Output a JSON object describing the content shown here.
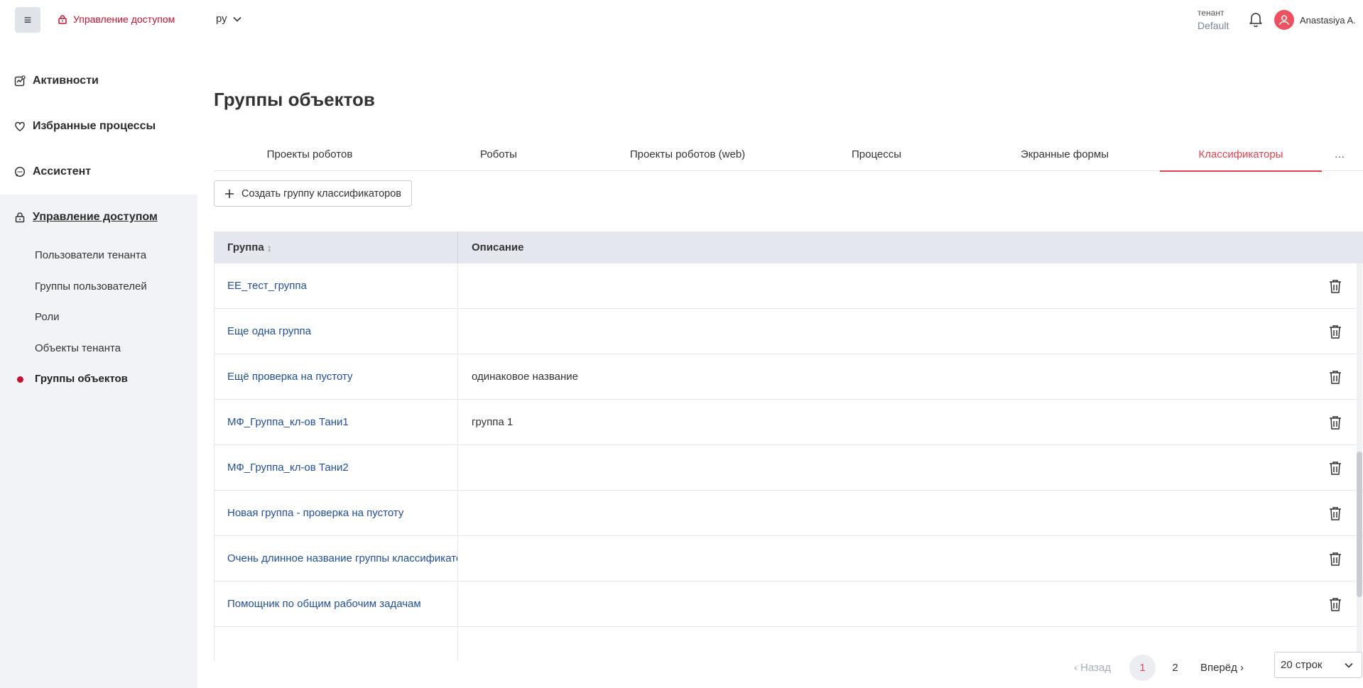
{
  "header": {
    "menu_icon": "hamburger-icon",
    "brand_label": "Управление доступом",
    "brand_color": "#c8102e",
    "language": "ру",
    "tenant_label": "тенант",
    "tenant_value": "Default",
    "user_name": "Anastasiya A."
  },
  "sidebar": {
    "top_items": [
      {
        "label": "Активности",
        "icon": "activity-icon"
      },
      {
        "label": "Избранные процессы",
        "icon": "heart-icon"
      },
      {
        "label": "Ассистент",
        "icon": "chat-icon"
      }
    ],
    "active_section": {
      "label": "Управление доступом",
      "icon": "lock-icon"
    },
    "sub_items": [
      "Пользователи тенанта",
      "Группы пользователей",
      "Роли",
      "Объекты тенанта",
      "Группы объектов"
    ],
    "current_sub": "Группы объектов"
  },
  "page": {
    "title": "Группы объектов",
    "tabs": [
      "Проекты роботов",
      "Роботы",
      "Проекты роботов (web)",
      "Процессы",
      "Экранные формы",
      "Классификаторы"
    ],
    "active_tab": "Классификаторы",
    "tabs_more": "…",
    "create_button": "Создать группу классификаторов"
  },
  "table": {
    "columns": [
      "Группа",
      "Описание"
    ],
    "rows": [
      {
        "group": "EE_тест_группа",
        "description": ""
      },
      {
        "group": "Еще одна группа",
        "description": ""
      },
      {
        "group": "Ещё проверка на пустоту",
        "description": "одинаковое название"
      },
      {
        "group": "МФ_Группа_кл-ов Тани1",
        "description": "группа 1"
      },
      {
        "group": "МФ_Группа_кл-ов Тани2",
        "description": ""
      },
      {
        "group": "Новая группа - проверка на пустоту",
        "description": ""
      },
      {
        "group": "Очень длинное название группы классификаторов",
        "description": ""
      },
      {
        "group": "Помощник по общим рабочим задачам",
        "description": ""
      }
    ]
  },
  "pagination": {
    "prev": "‹ Назад",
    "pages": [
      "1",
      "2"
    ],
    "current_page": "1",
    "next": "Вперёд ›",
    "rows_per_page": "20 строк"
  },
  "colors": {
    "accent": "#e2424f",
    "link": "#1f4fa3",
    "sidebar_bg": "#f2f3f6",
    "table_header_bg": "#e4e7ee"
  }
}
